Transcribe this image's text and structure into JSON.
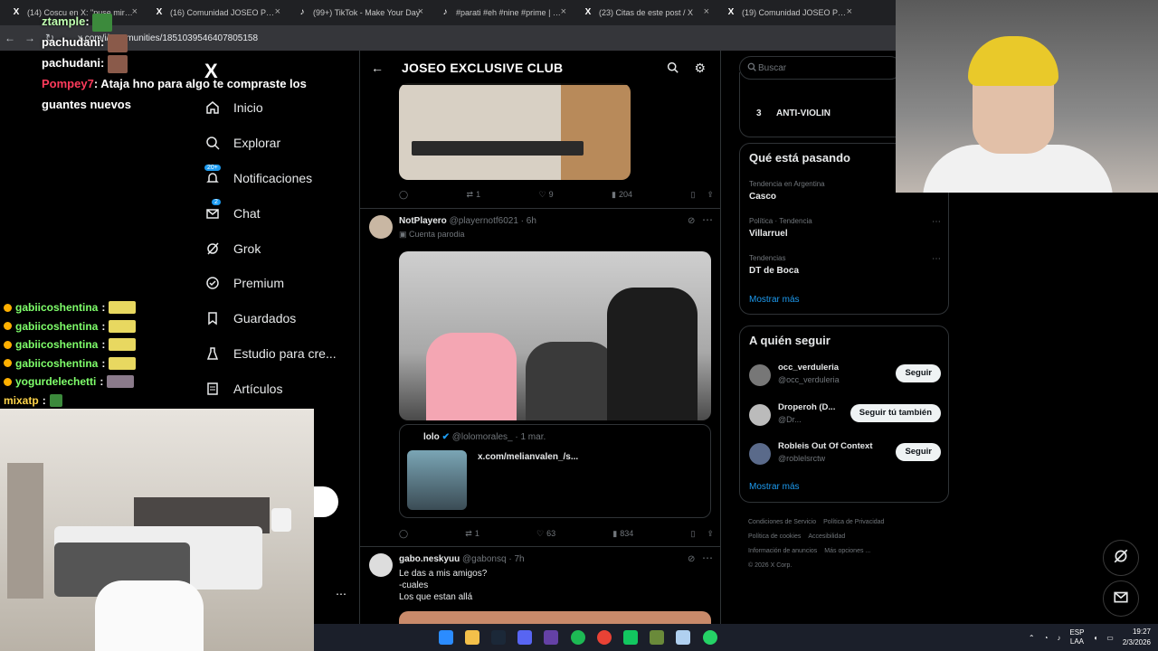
{
  "browser": {
    "tabs": [
      {
        "label": "(14) Coscu en X: \"puse mirar f...",
        "icon": "x-icon"
      },
      {
        "label": "(16) Comunidad JOSEO PRIME...",
        "icon": "x-icon"
      },
      {
        "label": "(99+) TikTok - Make Your Day",
        "icon": "tiktok-icon"
      },
      {
        "label": "#parati #eh #nine #prime | mo...",
        "icon": "tiktok-icon"
      },
      {
        "label": "(23) Citas de este post / X",
        "icon": "x-icon"
      },
      {
        "label": "(19) Comunidad JOSEO PRIME",
        "icon": "x-icon"
      }
    ],
    "url": "x.com/i/communities/1851039546407805158"
  },
  "stream_chat_top": [
    {
      "user": "ztample",
      "text": "",
      "color": "green"
    },
    {
      "user": "pachudani",
      "text": "",
      "color": "white"
    },
    {
      "user": "pachudani",
      "text": "",
      "color": "white"
    },
    {
      "user": "Pompey7",
      "text": "Ataja hno para algo te compraste los",
      "color": "red"
    },
    {
      "user": "",
      "text": "guantes nuevos",
      "color": "white"
    }
  ],
  "stream_chat_bottom": [
    {
      "user": "gabiicoshentina",
      "color": "green"
    },
    {
      "user": "gabiicoshentina",
      "color": "green"
    },
    {
      "user": "gabiicoshentina",
      "color": "green"
    },
    {
      "user": "gabiicoshentina",
      "color": "green"
    },
    {
      "user": "yogurdelechetti",
      "color": "green"
    },
    {
      "user": "mixatp",
      "color": "yellow"
    }
  ],
  "leftnav": {
    "logo": "X",
    "items": [
      {
        "label": "Inicio",
        "icon": "home-icon"
      },
      {
        "label": "Explorar",
        "icon": "search-icon"
      },
      {
        "label": "Notificaciones",
        "icon": "bell-icon",
        "badge": "20+"
      },
      {
        "label": "Chat",
        "icon": "mail-icon",
        "badge": "2"
      },
      {
        "label": "Grok",
        "icon": "grok-icon"
      },
      {
        "label": "Premium",
        "icon": "premium-icon"
      },
      {
        "label": "Guardados",
        "icon": "bookmark-icon"
      },
      {
        "label": "Estudio para cre...",
        "icon": "studio-icon"
      },
      {
        "label": "Artículos",
        "icon": "articles-icon"
      }
    ]
  },
  "main": {
    "title": "JOSEO EXCLUSIVE CLUB",
    "post1_actions": {
      "reply": "",
      "repost": "1",
      "like": "9",
      "views": "204"
    },
    "post2": {
      "name": "NotPlayero",
      "handle": "@playernotf6021 · 6h",
      "sublabel": "Cuenta parodia",
      "quote": {
        "name": "lolo",
        "handle": "@lolomorales_ · 1 mar.",
        "link": "x.com/melianvalen_/s..."
      },
      "actions": {
        "reply": "",
        "repost": "1",
        "like": "63",
        "views": "834"
      }
    },
    "post3": {
      "name": "gabo.neskyuu",
      "handle": "@gabonsq · 7h",
      "lines": [
        "Le das a mis amigos?",
        "-cuales",
        "Los que estan allá"
      ]
    }
  },
  "right": {
    "search_placeholder": "Buscar",
    "trend_top": {
      "rank": "3",
      "name": "ANTI-VIOLIN"
    },
    "happening": {
      "title": "Qué está pasando",
      "trends": [
        {
          "meta": "Tendencia en Argentina",
          "name": "Casco"
        },
        {
          "meta": "Política · Tendencia",
          "name": "Villarruel"
        },
        {
          "meta": "Tendencias",
          "name": "DT de Boca"
        }
      ],
      "show_more": "Mostrar más"
    },
    "follow": {
      "title": "A quién seguir",
      "users": [
        {
          "name": "occ_verduleria",
          "handle": "@occ_verduleria",
          "button": "Seguir"
        },
        {
          "name": "Droperoh (D...",
          "handle": "@Dr...",
          "button": "Seguir tú también"
        },
        {
          "name": "Robleis Out Of Context",
          "handle": "@roblelsrctw",
          "button": "Seguir"
        }
      ],
      "show_more": "Mostrar más"
    },
    "footer": [
      "Condiciones de Servicio",
      "Política de Privacidad",
      "Política de cookies",
      "Accesibilidad",
      "Información de anuncios",
      "Más opciones ...",
      "© 2026 X Corp."
    ]
  },
  "taskbar": {
    "lang": [
      "ESP",
      "LAA"
    ],
    "time": "19:27",
    "date": "2/3/2026"
  },
  "colors": {
    "accent": "#1d9bf0",
    "bg": "#000000",
    "text": "#e7e9ea",
    "muted": "#71767b"
  }
}
